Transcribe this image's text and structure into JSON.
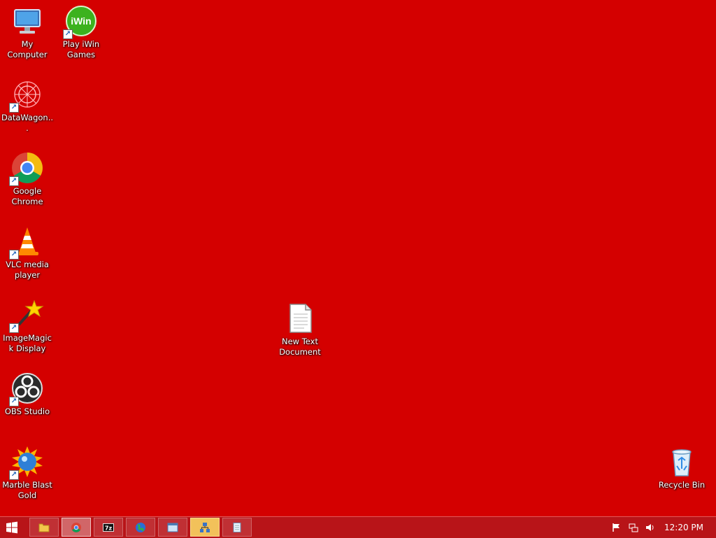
{
  "desktop": {
    "background_color": "#d40000",
    "icons": [
      {
        "name": "my-computer",
        "label": "My Computer",
        "icon": "computer-icon"
      },
      {
        "name": "play-iwin-games",
        "label": "Play iWin Games",
        "icon": "iwin-icon",
        "icon_text": "iWin"
      },
      {
        "name": "datawagon",
        "label": "DataWagon...",
        "icon": "datawagon-icon"
      },
      {
        "name": "google-chrome",
        "label": "Google Chrome",
        "icon": "chrome-icon"
      },
      {
        "name": "vlc-media-player",
        "label": "VLC media player",
        "icon": "vlc-icon"
      },
      {
        "name": "imagemagick-display",
        "label": "ImageMagick Display",
        "icon": "imagemagick-icon"
      },
      {
        "name": "obs-studio",
        "label": "OBS Studio",
        "icon": "obs-icon"
      },
      {
        "name": "marble-blast-gold",
        "label": "Marble Blast Gold",
        "icon": "marble-icon"
      },
      {
        "name": "new-text-document",
        "label": "New Text Document",
        "icon": "text-document-icon"
      },
      {
        "name": "recycle-bin",
        "label": "Recycle Bin",
        "icon": "recycle-bin-icon"
      }
    ]
  },
  "taskbar": {
    "color": "#b81418",
    "pinned": [
      {
        "name": "file-explorer",
        "icon": "folder-icon"
      },
      {
        "name": "chrome",
        "icon": "chrome-icon",
        "active": true
      },
      {
        "name": "7zip",
        "icon": "7zip-icon",
        "icon_text": "7z"
      },
      {
        "name": "globe-app",
        "icon": "globe-icon"
      },
      {
        "name": "window-app",
        "icon": "window-icon"
      },
      {
        "name": "network-app",
        "icon": "network-icon",
        "highlight": true
      },
      {
        "name": "notepad",
        "icon": "notepad-icon"
      }
    ],
    "tray": [
      "flag-icon",
      "network-icon",
      "volume-icon"
    ],
    "clock": "12:20 PM"
  }
}
